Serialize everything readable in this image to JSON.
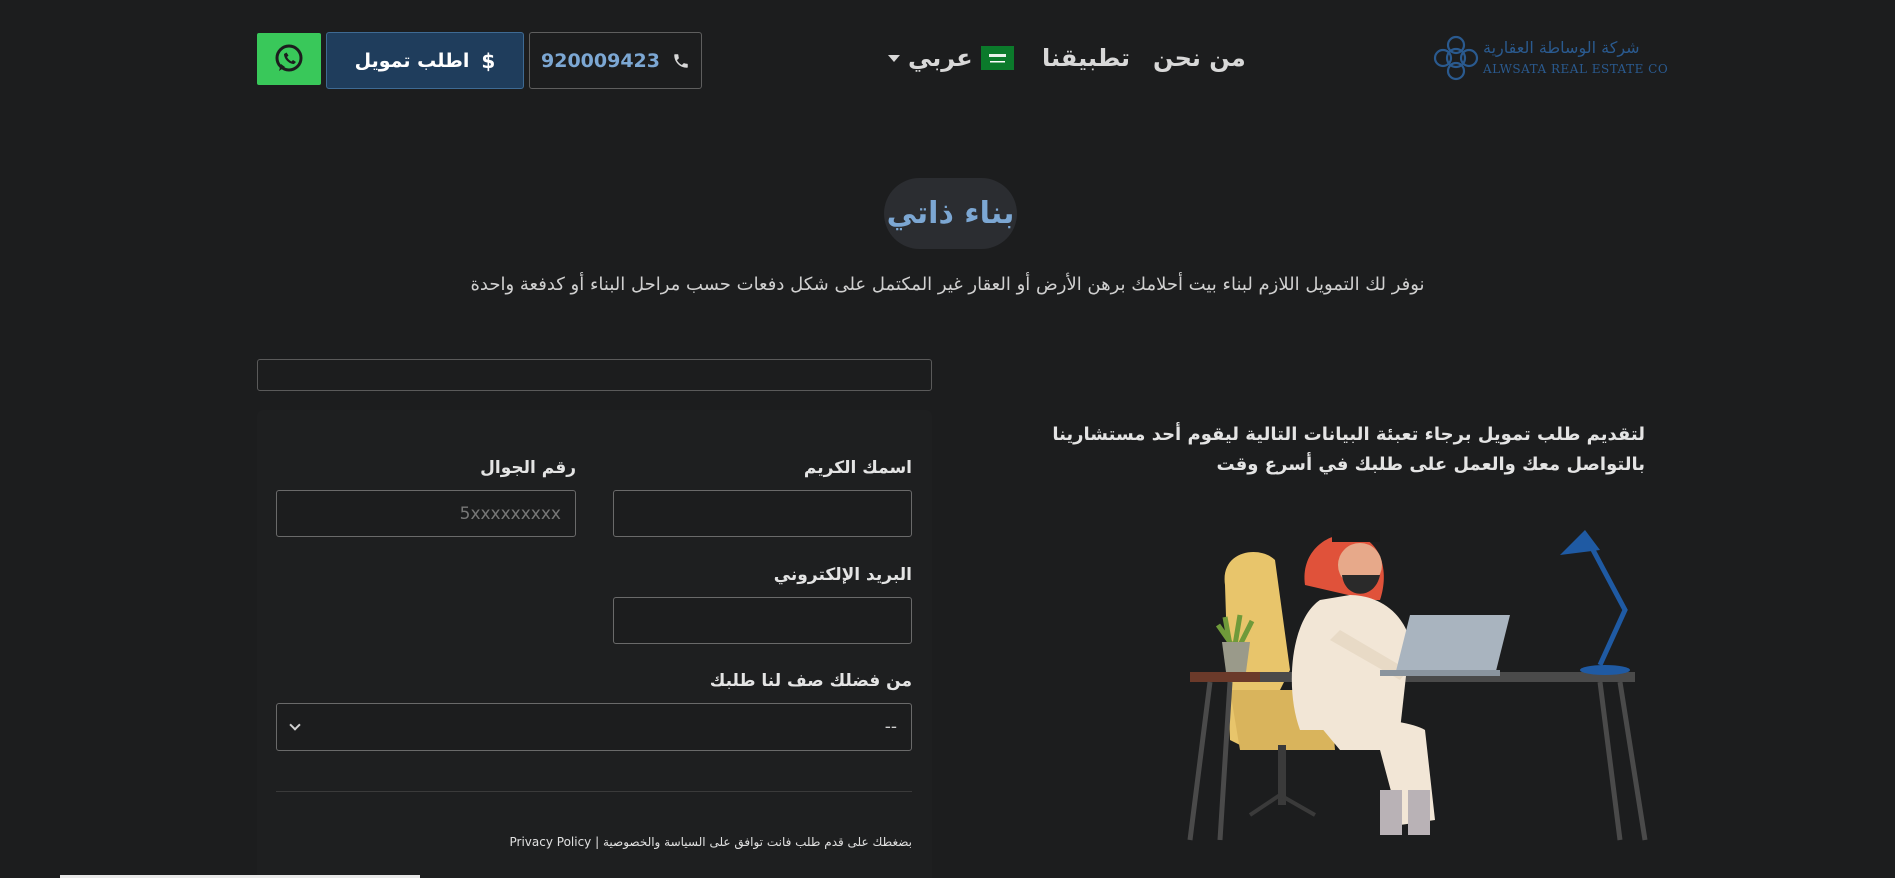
{
  "header": {
    "logo_ar": "شركة الوساطة العقارية",
    "logo_en": "ALWSATA REAL ESTATE CO",
    "nav_about": "من نحن",
    "nav_apps": "تطبيقنا",
    "language": "عربي",
    "phone": "920009423",
    "finance_button": "اطلب تمويل",
    "icons": [
      "phone-icon",
      "dollar-icon",
      "whatsapp-icon",
      "saudi-flag-icon",
      "caret-down-icon",
      "logo-icon"
    ]
  },
  "hero": {
    "title": "بناء ذاتي",
    "subtitle": "نوفر لك التمويل اللازم لبناء بيت أحلامك برهن الأرض أو العقار غير المكتمل على شكل دفعات حسب مراحل البناء أو كدفعة واحدة"
  },
  "form": {
    "name_label": "اسمك الكريم",
    "mobile_label": "رقم الجوال",
    "mobile_placeholder": "5xxxxxxxxx",
    "email_label": "البريد الإلكتروني",
    "desc_label": "من فضلك صف لنا طلبك",
    "select_value": "--",
    "policy_text": "بضغطك على قدم طلب فانت توافق على السياسة والخصوصية |",
    "policy_link": "Privacy Policy"
  },
  "intro": {
    "text": "لتقديم طلب تمويل برجاء تعبئة البيانات التالية ليقوم أحد مستشارينا بالتواصل معك والعمل على طلبك في أسرع وقت"
  },
  "colors": {
    "background": "#1c1d1e",
    "accent_blue": "#7ca7d3",
    "finance_button": "#1f3d5c",
    "whatsapp": "#39c85a"
  }
}
